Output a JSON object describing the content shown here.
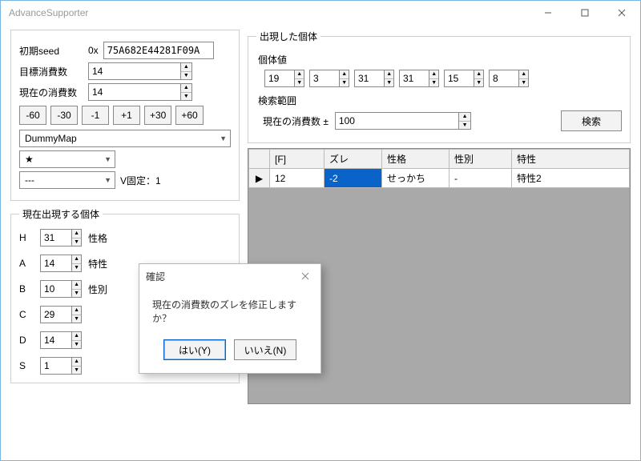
{
  "window": {
    "title": "AdvanceSupporter"
  },
  "seed": {
    "label": "初期seed",
    "prefix": "0x",
    "value": "75A682E44281F09A"
  },
  "target": {
    "label": "目標消費数",
    "value": "14"
  },
  "current": {
    "label": "現在の消費数",
    "value": "14"
  },
  "step_buttons": [
    "-60",
    "-30",
    "-1",
    "+1",
    "+30",
    "+60"
  ],
  "map_combo": "DummyMap",
  "star_combo": "★",
  "dash_combo": "---",
  "vfixed_label": "V固定：1",
  "current_iv_group": "現在出現する個体",
  "iv_labels": {
    "H": "H",
    "A": "A",
    "B": "B",
    "C": "C",
    "D": "D",
    "S": "S"
  },
  "iv_values": {
    "H": "31",
    "A": "14",
    "B": "10",
    "C": "29",
    "D": "14",
    "S": "1"
  },
  "iv_extra_labels": {
    "nature": "性格",
    "ability": "特性",
    "gender": "性別"
  },
  "appeared_group": "出現した個体",
  "appeared_sub": "個体値",
  "appeared_ivs": [
    "19",
    "3",
    "31",
    "31",
    "15",
    "8"
  ],
  "search_range_label": "検索範囲",
  "search_range_sub": "現在の消費数 ±",
  "search_range_value": "100",
  "search_button": "検索",
  "grid": {
    "cols": [
      "[F]",
      "ズレ",
      "性格",
      "性別",
      "特性"
    ],
    "row": {
      "f": "12",
      "zure": "-2",
      "nature": "せっかち",
      "gender": "-",
      "ability": "特性2"
    }
  },
  "modal": {
    "title": "確認",
    "text": "現在の消費数のズレを修正しますか？",
    "yes": "はい(Y)",
    "no": "いいえ(N)"
  }
}
